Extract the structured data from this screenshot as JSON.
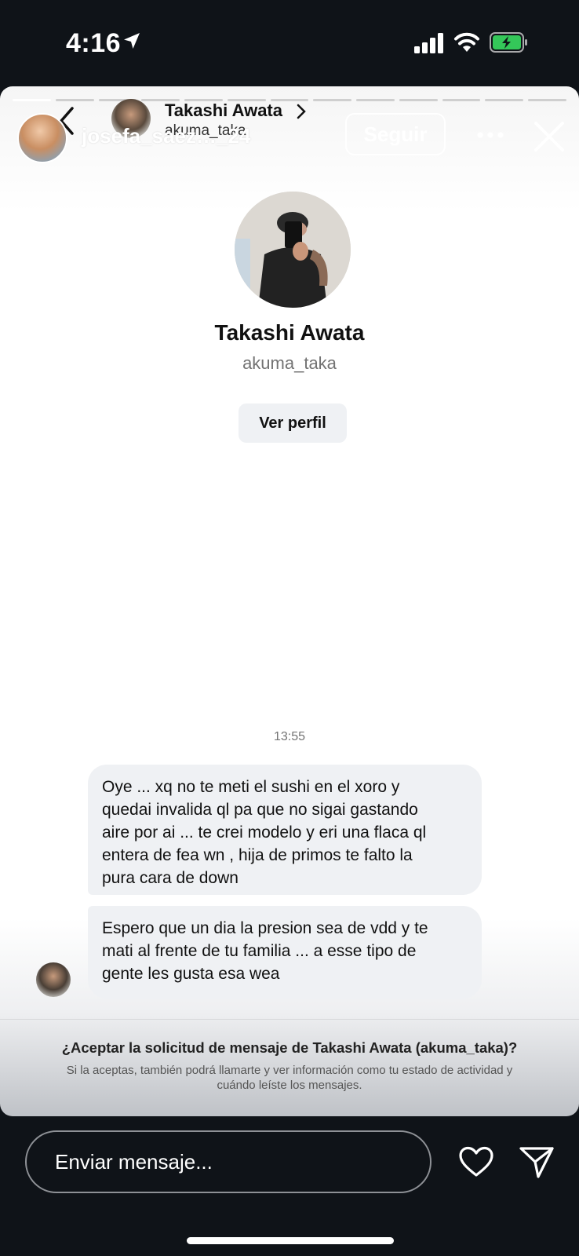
{
  "status_bar": {
    "time": "4:16"
  },
  "story": {
    "poster_username": "josefa_saez…_24",
    "follow_label": "Seguir"
  },
  "dm": {
    "header_name": "Takashi Awata",
    "header_username": "akuma_taka",
    "profile_name": "Takashi Awata",
    "profile_username": "akuma_taka",
    "view_profile_label": "Ver perfil",
    "timestamp": "13:55",
    "messages": [
      {
        "text": "Oye ... xq no te meti el sushi en el xoro y\nquedai invalida ql pa que no sigai gastando\naire por ai ... te crei modelo y eri una flaca ql\nentera de fea wn , hija de primos te falto la\npura cara de down"
      },
      {
        "text": "Espero que un dia la presion sea de vdd y te\nmati al frente de tu familia ... a esse tipo de\ngente les gusta esa wea"
      }
    ],
    "request_title": "¿Aceptar la solicitud de mensaje de Takashi Awata (akuma_taka)?",
    "request_description": "Si la aceptas, también podrá llamarte y ver información como tu estado de actividad y cuándo leíste los mensajes."
  },
  "reply": {
    "placeholder": "Enviar mensaje..."
  },
  "icons": {
    "location": "location-arrow-icon",
    "signal": "signal-icon",
    "wifi": "wifi-icon",
    "battery": "battery-charging-icon",
    "more": "more-icon",
    "close": "close-icon",
    "back": "back-chevron-icon",
    "chevron": "chevron-right-icon",
    "heart": "heart-icon",
    "send": "send-icon"
  },
  "colors": {
    "background": "#0f1318",
    "bubble": "#eff1f4",
    "battery_green": "#34c759"
  }
}
